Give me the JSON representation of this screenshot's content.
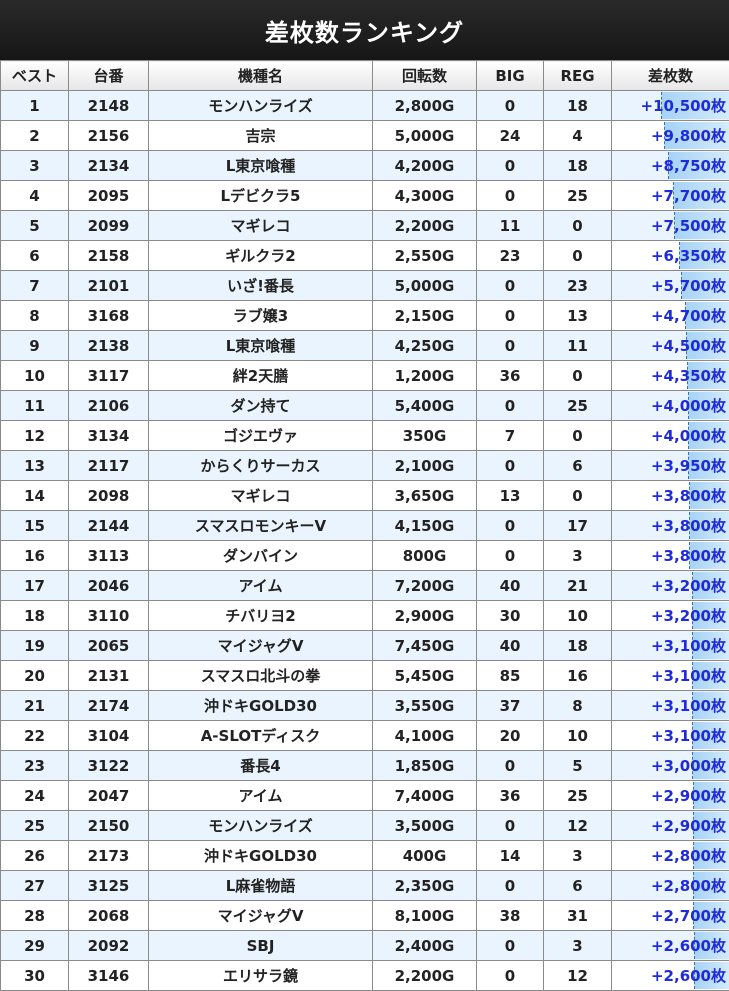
{
  "title": "差枚数ランキング",
  "columns": [
    "ベスト",
    "台番",
    "機種名",
    "回転数",
    "BIG",
    "REG",
    "差枚数"
  ],
  "accent_color": "#1f2ad8",
  "rows": [
    {
      "rank": "1",
      "machine_no": "2148",
      "name": "モンハンライズ",
      "spins": "2,800G",
      "big": "0",
      "reg": "18",
      "diff": "+10,500枚",
      "diff_value": 10500
    },
    {
      "rank": "2",
      "machine_no": "2156",
      "name": "吉宗",
      "spins": "5,000G",
      "big": "24",
      "reg": "4",
      "diff": "+9,800枚",
      "diff_value": 9800
    },
    {
      "rank": "3",
      "machine_no": "2134",
      "name": "L東京喰種",
      "spins": "4,200G",
      "big": "0",
      "reg": "18",
      "diff": "+8,750枚",
      "diff_value": 8750
    },
    {
      "rank": "4",
      "machine_no": "2095",
      "name": "Lデビクラ5",
      "spins": "4,300G",
      "big": "0",
      "reg": "25",
      "diff": "+7,700枚",
      "diff_value": 7700
    },
    {
      "rank": "5",
      "machine_no": "2099",
      "name": "マギレコ",
      "spins": "2,200G",
      "big": "11",
      "reg": "0",
      "diff": "+7,500枚",
      "diff_value": 7500
    },
    {
      "rank": "6",
      "machine_no": "2158",
      "name": "ギルクラ2",
      "spins": "2,550G",
      "big": "23",
      "reg": "0",
      "diff": "+6,350枚",
      "diff_value": 6350
    },
    {
      "rank": "7",
      "machine_no": "2101",
      "name": "いざ!番長",
      "spins": "5,000G",
      "big": "0",
      "reg": "23",
      "diff": "+5,700枚",
      "diff_value": 5700
    },
    {
      "rank": "8",
      "machine_no": "3168",
      "name": "ラブ嬢3",
      "spins": "2,150G",
      "big": "0",
      "reg": "13",
      "diff": "+4,700枚",
      "diff_value": 4700
    },
    {
      "rank": "9",
      "machine_no": "2138",
      "name": "L東京喰種",
      "spins": "4,250G",
      "big": "0",
      "reg": "11",
      "diff": "+4,500枚",
      "diff_value": 4500
    },
    {
      "rank": "10",
      "machine_no": "3117",
      "name": "絆2天膳",
      "spins": "1,200G",
      "big": "36",
      "reg": "0",
      "diff": "+4,350枚",
      "diff_value": 4350
    },
    {
      "rank": "11",
      "machine_no": "2106",
      "name": "ダン持て",
      "spins": "5,400G",
      "big": "0",
      "reg": "25",
      "diff": "+4,000枚",
      "diff_value": 4000
    },
    {
      "rank": "12",
      "machine_no": "3134",
      "name": "ゴジエヴァ",
      "spins": "350G",
      "big": "7",
      "reg": "0",
      "diff": "+4,000枚",
      "diff_value": 4000
    },
    {
      "rank": "13",
      "machine_no": "2117",
      "name": "からくりサーカス",
      "spins": "2,100G",
      "big": "0",
      "reg": "6",
      "diff": "+3,950枚",
      "diff_value": 3950
    },
    {
      "rank": "14",
      "machine_no": "2098",
      "name": "マギレコ",
      "spins": "3,650G",
      "big": "13",
      "reg": "0",
      "diff": "+3,800枚",
      "diff_value": 3800
    },
    {
      "rank": "15",
      "machine_no": "2144",
      "name": "スマスロモンキーV",
      "spins": "4,150G",
      "big": "0",
      "reg": "17",
      "diff": "+3,800枚",
      "diff_value": 3800
    },
    {
      "rank": "16",
      "machine_no": "3113",
      "name": "ダンバイン",
      "spins": "800G",
      "big": "0",
      "reg": "3",
      "diff": "+3,800枚",
      "diff_value": 3800
    },
    {
      "rank": "17",
      "machine_no": "2046",
      "name": "アイム",
      "spins": "7,200G",
      "big": "40",
      "reg": "21",
      "diff": "+3,200枚",
      "diff_value": 3200
    },
    {
      "rank": "18",
      "machine_no": "3110",
      "name": "チバリヨ2",
      "spins": "2,900G",
      "big": "30",
      "reg": "10",
      "diff": "+3,200枚",
      "diff_value": 3200
    },
    {
      "rank": "19",
      "machine_no": "2065",
      "name": "マイジャグV",
      "spins": "7,450G",
      "big": "40",
      "reg": "18",
      "diff": "+3,100枚",
      "diff_value": 3100
    },
    {
      "rank": "20",
      "machine_no": "2131",
      "name": "スマスロ北斗の拳",
      "spins": "5,450G",
      "big": "85",
      "reg": "16",
      "diff": "+3,100枚",
      "diff_value": 3100
    },
    {
      "rank": "21",
      "machine_no": "2174",
      "name": "沖ドキGOLD30",
      "spins": "3,550G",
      "big": "37",
      "reg": "8",
      "diff": "+3,100枚",
      "diff_value": 3100
    },
    {
      "rank": "22",
      "machine_no": "3104",
      "name": "A-SLOTディスク",
      "spins": "4,100G",
      "big": "20",
      "reg": "10",
      "diff": "+3,100枚",
      "diff_value": 3100
    },
    {
      "rank": "23",
      "machine_no": "3122",
      "name": "番長4",
      "spins": "1,850G",
      "big": "0",
      "reg": "5",
      "diff": "+3,000枚",
      "diff_value": 3000
    },
    {
      "rank": "24",
      "machine_no": "2047",
      "name": "アイム",
      "spins": "7,400G",
      "big": "36",
      "reg": "25",
      "diff": "+2,900枚",
      "diff_value": 2900
    },
    {
      "rank": "25",
      "machine_no": "2150",
      "name": "モンハンライズ",
      "spins": "3,500G",
      "big": "0",
      "reg": "12",
      "diff": "+2,900枚",
      "diff_value": 2900
    },
    {
      "rank": "26",
      "machine_no": "2173",
      "name": "沖ドキGOLD30",
      "spins": "400G",
      "big": "14",
      "reg": "3",
      "diff": "+2,800枚",
      "diff_value": 2800
    },
    {
      "rank": "27",
      "machine_no": "3125",
      "name": "L麻雀物語",
      "spins": "2,350G",
      "big": "0",
      "reg": "6",
      "diff": "+2,800枚",
      "diff_value": 2800
    },
    {
      "rank": "28",
      "machine_no": "2068",
      "name": "マイジャグV",
      "spins": "8,100G",
      "big": "38",
      "reg": "31",
      "diff": "+2,700枚",
      "diff_value": 2700
    },
    {
      "rank": "29",
      "machine_no": "2092",
      "name": "SBJ",
      "spins": "2,400G",
      "big": "0",
      "reg": "3",
      "diff": "+2,600枚",
      "diff_value": 2600
    },
    {
      "rank": "30",
      "machine_no": "3146",
      "name": "エリサラ鏡",
      "spins": "2,200G",
      "big": "0",
      "reg": "12",
      "diff": "+2,600枚",
      "diff_value": 2600
    }
  ]
}
